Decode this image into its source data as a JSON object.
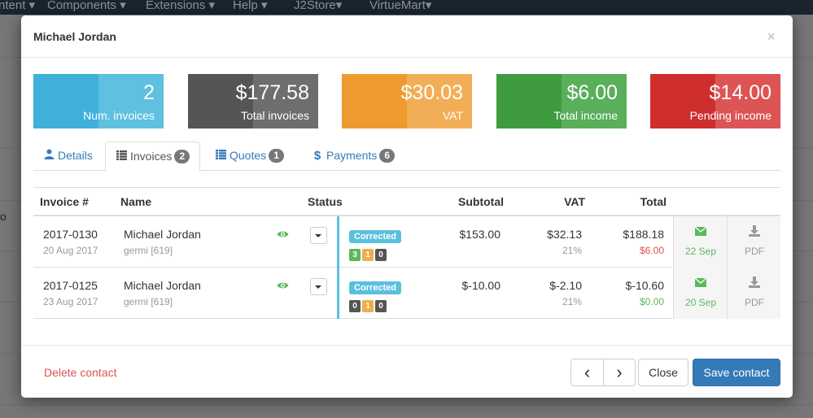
{
  "background": {
    "nav": [
      {
        "label": "ntent ▾"
      },
      {
        "label": "Components ▾"
      },
      {
        "label": "Extensions ▾"
      },
      {
        "label": "Help ▾"
      },
      {
        "label": "J2Store▾"
      },
      {
        "label": "VirtueMart▾"
      }
    ],
    "side_text": "o"
  },
  "modal": {
    "title": "Michael Jordan",
    "close_label": "×"
  },
  "stats": [
    {
      "value": "2",
      "label": "Num. invoices",
      "color": "#3fb0d9",
      "half_color": "#5fc0e0"
    },
    {
      "value": "$177.58",
      "label": "Total invoices",
      "color": "#555555",
      "half_color": "#6e6e6e"
    },
    {
      "value": "$30.03",
      "label": "VAT",
      "color": "#ef9a2f",
      "half_color": "#f2ae57"
    },
    {
      "value": "$6.00",
      "label": "Total income",
      "color": "#3f9b3f",
      "half_color": "#5aaf5a"
    },
    {
      "value": "$14.00",
      "label": "Pending income",
      "color": "#cf2e2e",
      "half_color": "#dc5454"
    }
  ],
  "tabs": [
    {
      "label": "Details",
      "icon": "user-icon",
      "badge": ""
    },
    {
      "label": "Invoices",
      "icon": "list-icon",
      "badge": "2"
    },
    {
      "label": "Quotes",
      "icon": "list-icon",
      "badge": "1"
    },
    {
      "label": "Payments",
      "icon": "dollar-icon",
      "badge": "6"
    }
  ],
  "table": {
    "headers": {
      "invoice": "Invoice #",
      "name": "Name",
      "status": "Status",
      "subtotal": "Subtotal",
      "vat": "VAT",
      "total": "Total"
    },
    "rows": [
      {
        "number": "2017-0130",
        "date": "20 Aug 2017",
        "name": "Michael Jordan",
        "sub": "germi [619]",
        "status": "Corrected",
        "counts": [
          "3",
          "1",
          "0"
        ],
        "subtotal": "$153.00",
        "vat": "$32.13",
        "vat_pct": "21%",
        "total": "$188.18",
        "pending": "$6.00",
        "pending_color": "#d9534f",
        "sent_date": "22 Sep",
        "pdf": "PDF"
      },
      {
        "number": "2017-0125",
        "date": "23 Aug 2017",
        "name": "Michael Jordan",
        "sub": "germi [619]",
        "status": "Corrected",
        "counts": [
          "0",
          "1",
          "0"
        ],
        "subtotal": "$-10.00",
        "vat": "$-2.10",
        "vat_pct": "21%",
        "total": "$-10.60",
        "pending": "$0.00",
        "pending_color": "#5cb85c",
        "sent_date": "20 Sep",
        "pdf": "PDF"
      }
    ]
  },
  "footer": {
    "delete": "Delete contact",
    "prev": "‹",
    "next": "›",
    "close": "Close",
    "save": "Save contact"
  }
}
